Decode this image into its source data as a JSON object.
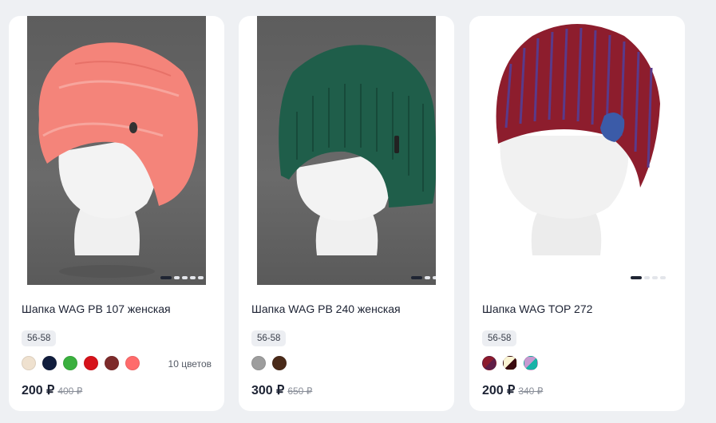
{
  "products": [
    {
      "title": "Шапка WAG PB 107 женская",
      "size": "56-58",
      "swatches": [
        "#efe1cf",
        "#111d3d",
        "#3ab03e",
        "#d6121a",
        "#7d2b2b",
        "#ff6b6b"
      ],
      "colors_count": "10 цветов",
      "price": "200 ₽",
      "old_price": "400 ₽",
      "slider_active_index": 0
    },
    {
      "title": "Шапка WAG PB 240 женская",
      "size": "56-58",
      "swatches": [
        "#9d9d9d",
        "#4a2a19"
      ],
      "colors_count": "",
      "price": "300 ₽",
      "old_price": "650 ₽",
      "slider_active_index": 0
    },
    {
      "title": "Шапка WAG TOP 272",
      "size": "56-58",
      "swatches": [
        "split:#8c1b2e:#5e1d47",
        "split:#fbf4d3:#3b0b10",
        "split:#18b3a8:#c69ad1"
      ],
      "colors_count": "",
      "price": "200 ₽",
      "old_price": "340 ₽",
      "slider_active_index": 0
    }
  ],
  "colors": {
    "hat1": "#f4847a",
    "hat2": "#1f5e4a",
    "hat3": "#8d1d2d",
    "hat3_stripe": "#5a3a8a",
    "mannequin": "#f2f2f2"
  }
}
